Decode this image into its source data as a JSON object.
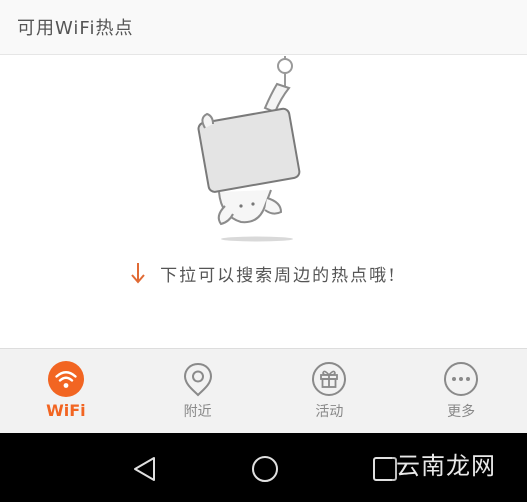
{
  "header": {
    "title": "可用WiFi热点"
  },
  "empty_state": {
    "hint": "下拉可以搜索周边的热点哦!",
    "arrow_icon": "arrow-down-icon",
    "mascot_icon": "hanging-mascot-icon"
  },
  "tabs": [
    {
      "label": "WiFi",
      "icon": "wifi-icon",
      "active": true
    },
    {
      "label": "附近",
      "icon": "location-pin-icon",
      "active": false
    },
    {
      "label": "活动",
      "icon": "gift-icon",
      "active": false
    },
    {
      "label": "更多",
      "icon": "more-dots-icon",
      "active": false
    }
  ],
  "navbar": {
    "back_icon": "back-triangle-icon",
    "home_icon": "home-circle-icon",
    "recent_icon": "recent-square-icon"
  },
  "watermark": {
    "text": "云南龙网"
  },
  "colors": {
    "accent": "#f26522",
    "header_bg": "#f9f9f9",
    "tabbar_bg": "#f2f2f2",
    "inactive": "#888888",
    "navbar_bg": "#000000"
  }
}
